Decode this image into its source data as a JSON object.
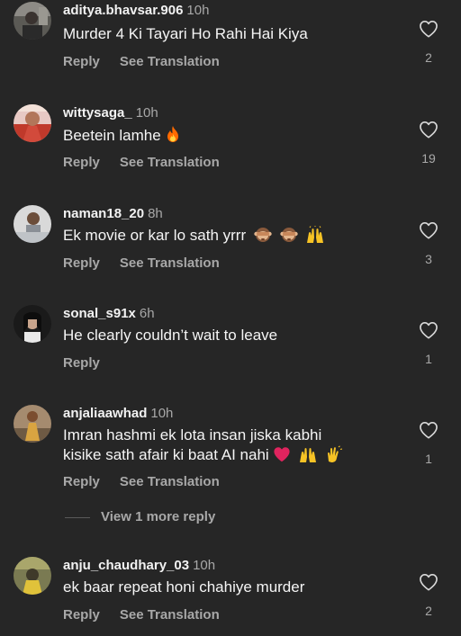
{
  "colors": {
    "background": "#262626",
    "username": "#f2f2f2",
    "secondary_text": "#a8a8a8",
    "heart_red": "#e0245e",
    "fire_orange": "#ff6a00",
    "hands_yellow": "#f7c325"
  },
  "comments": [
    {
      "username": "aditya.bhavsar.906",
      "time": "10h",
      "text": "Murder 4 Ki Tayari Ho Rahi Hai Kiya",
      "reply_label": "Reply",
      "translate_label": "See Translation",
      "likes": "2",
      "avatar": "avatar-photo"
    },
    {
      "username": "wittysaga_",
      "time": "10h",
      "text": "Beetein lamhe",
      "emoji": "fire-emoji",
      "reply_label": "Reply",
      "translate_label": "See Translation",
      "likes": "19",
      "avatar": "avatar-photo"
    },
    {
      "username": "naman18_20",
      "time": "8h",
      "text": "Ek movie or kar lo sath yrrr",
      "emoji": "see-no-evil-monkey-emoji, see-no-evil-monkey-emoji, raising-hands-emoji",
      "reply_label": "Reply",
      "translate_label": "See Translation",
      "likes": "3",
      "avatar": "avatar-photo"
    },
    {
      "username": "sonal_s91x",
      "time": "6h",
      "text": "He clearly couldn’t wait to leave",
      "reply_label": "Reply",
      "likes": "1",
      "avatar": "avatar-photo"
    },
    {
      "username": "anjaliaawhad",
      "time": "10h",
      "text_line1": "Imran hashmi ek lota insan jiska kabhi",
      "text_line2": "kisike sath afair ki baat AI nahi",
      "emoji": "red-heart-emoji, raising-hands-emoji, clapping-hands-emoji",
      "reply_label": "Reply",
      "translate_label": "See Translation",
      "likes": "1",
      "avatar": "avatar-photo"
    },
    {
      "username": "anju_chaudhary_03",
      "time": "10h",
      "text": "ek baar repeat honi chahiye murder",
      "reply_label": "Reply",
      "translate_label": "See Translation",
      "likes": "2",
      "avatar": "avatar-photo"
    }
  ],
  "view_more_replies": "View 1 more reply"
}
